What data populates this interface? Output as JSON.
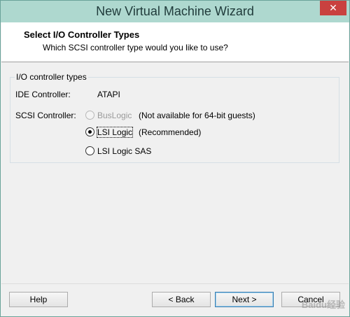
{
  "window": {
    "title": "New Virtual Machine Wizard",
    "close_glyph": "✕"
  },
  "header": {
    "title": "Select I/O Controller Types",
    "subtitle": "Which SCSI controller type would you like to use?"
  },
  "group": {
    "label": "I/O controller types",
    "ide_label": "IDE Controller:",
    "ide_value": "ATAPI",
    "scsi_label": "SCSI Controller:",
    "options": [
      {
        "label": "BusLogic",
        "note": "(Not available for 64-bit guests)",
        "selected": false,
        "disabled": true
      },
      {
        "label": "LSI Logic",
        "note": "(Recommended)",
        "selected": true,
        "disabled": false
      },
      {
        "label": "LSI Logic SAS",
        "note": "",
        "selected": false,
        "disabled": false
      }
    ]
  },
  "buttons": {
    "help": "Help",
    "back": "< Back",
    "next": "Next >",
    "cancel": "Cancel"
  },
  "watermark": "Baidu经验"
}
